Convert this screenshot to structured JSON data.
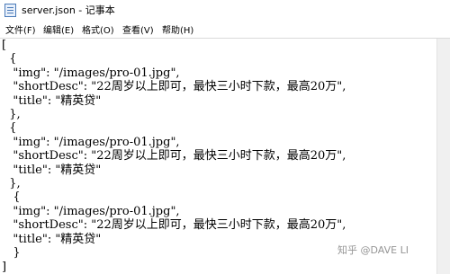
{
  "window": {
    "title": "server.json - 记事本",
    "icon": "notepad-icon"
  },
  "menu": [
    {
      "label": "文件(F)"
    },
    {
      "label": "编辑(E)"
    },
    {
      "label": "格式(O)"
    },
    {
      "label": "查看(V)"
    },
    {
      "label": "帮助(H)"
    }
  ],
  "document": {
    "lines": [
      "[",
      "  {",
      "   \"img\": \"/images/pro-01.jpg\",",
      "   \"shortDesc\": \"22周岁以上即可，最快三小时下款，最高20万\",",
      "   \"title\": \"精英贷\"",
      "  },",
      "  {",
      "   \"img\": \"/images/pro-01.jpg\",",
      "   \"shortDesc\": \"22周岁以上即可，最快三小时下款，最高20万\",",
      "   \"title\": \"精英贷\"",
      "  },",
      "   {",
      "   \"img\": \"/images/pro-01.jpg\",",
      "   \"shortDesc\": \"22周岁以上即可，最快三小时下款，最高20万\",",
      "   \"title\": \"精英贷\"",
      "   }",
      "]"
    ]
  },
  "watermark": "知乎 @DAVE LI"
}
